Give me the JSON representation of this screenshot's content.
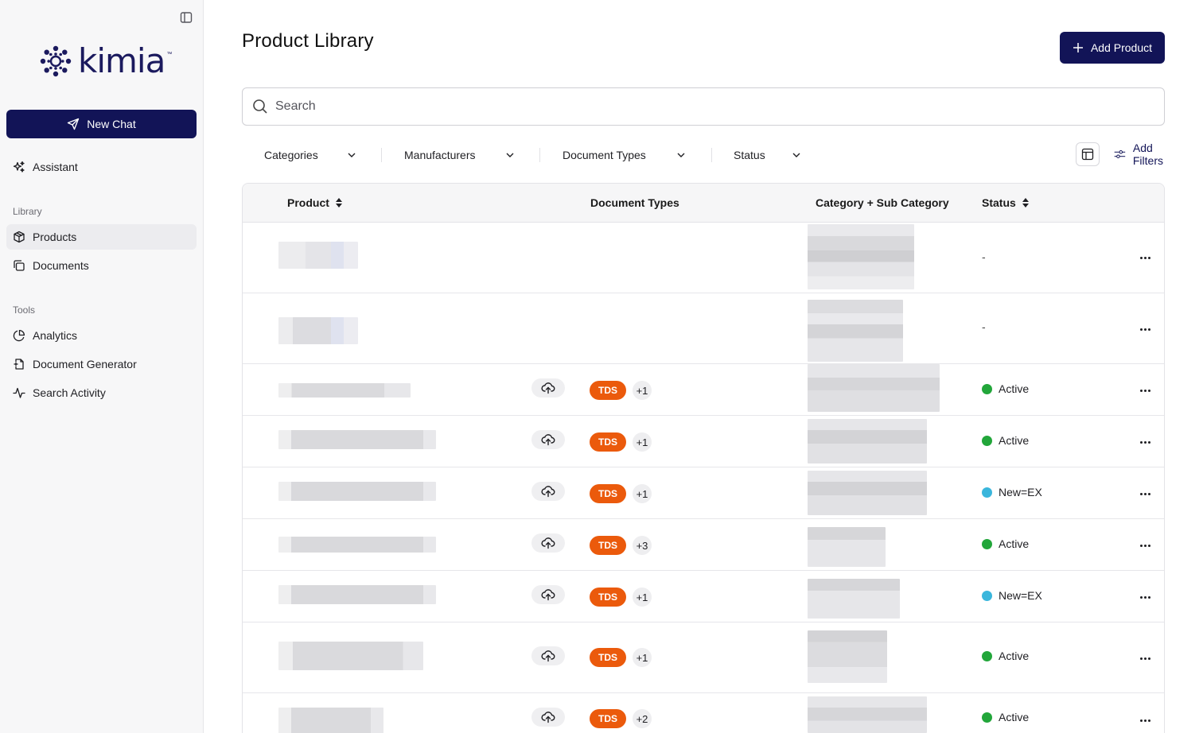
{
  "sidebar": {
    "logo_text": "kimia",
    "logo_mark": "™",
    "new_chat_label": "New Chat",
    "assistant_label": "Assistant",
    "sections": {
      "library_label": "Library",
      "tools_label": "Tools"
    },
    "library_items": [
      {
        "label": "Products",
        "icon": "box-icon",
        "active": true
      },
      {
        "label": "Documents",
        "icon": "documents-icon",
        "active": false
      }
    ],
    "tools_items": [
      {
        "label": "Analytics",
        "icon": "pie-chart-icon"
      },
      {
        "label": "Document Generator",
        "icon": "file-plus-icon"
      },
      {
        "label": "Search Activity",
        "icon": "activity-icon"
      }
    ]
  },
  "header": {
    "title": "Product Library",
    "add_product_label": "Add Product"
  },
  "search": {
    "placeholder": "Search",
    "value": ""
  },
  "filters": {
    "items": [
      "Categories",
      "Manufacturers",
      "Document Types",
      "Status"
    ],
    "add_filters_label": "Add Filters"
  },
  "table": {
    "columns": {
      "product": "Product",
      "document_types": "Document Types",
      "category": "Category + Sub Category",
      "status": "Status"
    },
    "rows": [
      {
        "doc_badge": "",
        "extra_count": "",
        "status": "-",
        "status_color": ""
      },
      {
        "doc_badge": "",
        "extra_count": "",
        "status": "-",
        "status_color": ""
      },
      {
        "doc_badge": "TDS",
        "extra_count": "+1",
        "status": "Active",
        "status_color": "#22a63a"
      },
      {
        "doc_badge": "TDS",
        "extra_count": "+1",
        "status": "Active",
        "status_color": "#22a63a"
      },
      {
        "doc_badge": "TDS",
        "extra_count": "+1",
        "status": "New=EX",
        "status_color": "#3ab6dc"
      },
      {
        "doc_badge": "TDS",
        "extra_count": "+3",
        "status": "Active",
        "status_color": "#22a63a"
      },
      {
        "doc_badge": "TDS",
        "extra_count": "+1",
        "status": "New=EX",
        "status_color": "#3ab6dc"
      },
      {
        "doc_badge": "TDS",
        "extra_count": "+1",
        "status": "Active",
        "status_color": "#22a63a"
      },
      {
        "doc_badge": "TDS",
        "extra_count": "+2",
        "status": "Active",
        "status_color": "#22a63a"
      }
    ]
  },
  "colors": {
    "brand": "#121457",
    "tds_badge": "#eb5a0c",
    "active": "#22a63a",
    "new_ex": "#3ab6dc"
  }
}
